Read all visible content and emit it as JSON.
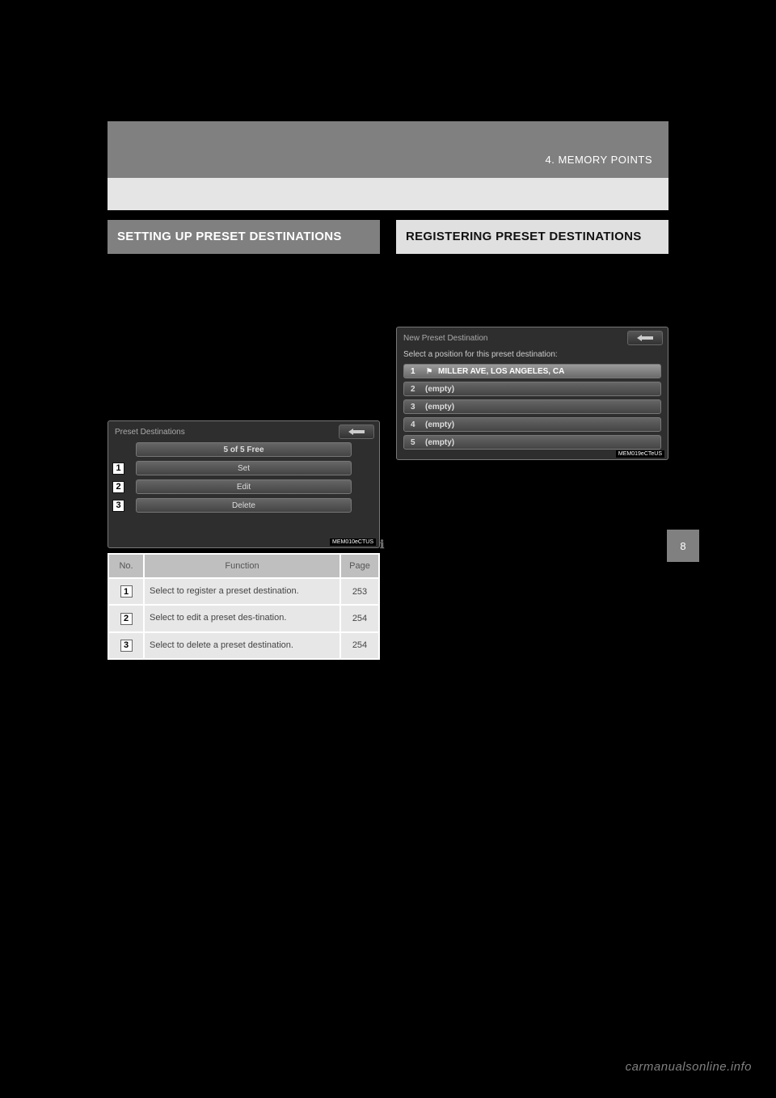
{
  "header": {
    "chapter": "4. MEMORY POINTS"
  },
  "side_tab": "8",
  "left": {
    "section_title": "SETTING UP PRESET DESTINATIONS",
    "screenshot": {
      "title": "Preset Destinations",
      "free_label": "5 of 5 Free",
      "buttons": {
        "set": "Set",
        "edit": "Edit",
        "delete": "Delete"
      },
      "image_id": "MEM010eCTUS"
    },
    "table": {
      "headers": {
        "no": "No.",
        "func": "Function",
        "page": "Page"
      },
      "rows": [
        {
          "num": "1",
          "func": "Select to register a preset destination.",
          "page": "253"
        },
        {
          "num": "2",
          "func": "Select to edit a preset des-tination.",
          "page": "254"
        },
        {
          "num": "3",
          "func": "Select to delete a preset destination.",
          "page": "254"
        }
      ]
    }
  },
  "right": {
    "section_title": "REGISTERING PRESET DESTINATIONS",
    "screenshot": {
      "title": "New Preset Destination",
      "subtitle": "Select a position for this preset destination:",
      "rows": [
        {
          "num": "1",
          "label": "MILLER AVE, LOS ANGELES, CA",
          "flag": true
        },
        {
          "num": "2",
          "label": "(empty)",
          "flag": false
        },
        {
          "num": "3",
          "label": "(empty)",
          "flag": false
        },
        {
          "num": "4",
          "label": "(empty)",
          "flag": false
        },
        {
          "num": "5",
          "label": "(empty)",
          "flag": false
        }
      ],
      "image_id": "MEM019eCTeUS"
    }
  },
  "watermark": "carmanualsonline.info"
}
